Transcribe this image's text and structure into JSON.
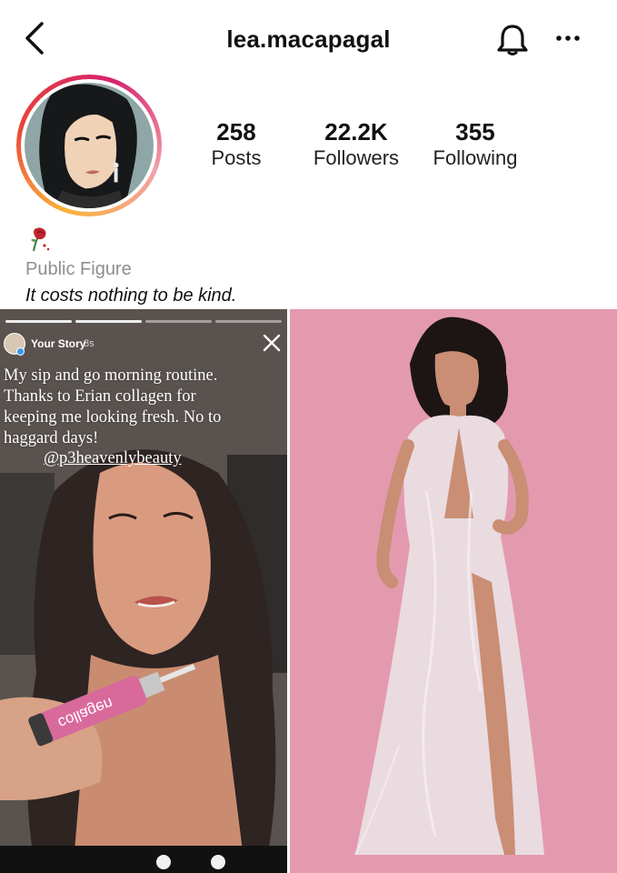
{
  "header": {
    "username": "lea.macapagal",
    "back_icon": "chevron-left-icon",
    "bell_icon": "bell-icon",
    "more_icon": "more-horizontal-icon"
  },
  "profile": {
    "posts": {
      "count": "258",
      "label": "Posts"
    },
    "followers": {
      "count": "22.2K",
      "label": "Followers"
    },
    "following": {
      "count": "355",
      "label": "Following"
    },
    "category": "Public Figure",
    "bio": "It costs nothing to be kind.",
    "bio_icon": "rose-icon"
  },
  "story": {
    "name": "Your Story",
    "time": "8s",
    "caption": "My sip and go morning routine. Thanks to Erian collagen for keeping me looking fresh. No to haggard days!",
    "mention": "@p3heavenlybeauty",
    "product_text": "collagen"
  },
  "colors": {
    "category_gray": "#8e8e8e",
    "story_badge": "#3897f0",
    "photo_background": "#e39aae"
  }
}
